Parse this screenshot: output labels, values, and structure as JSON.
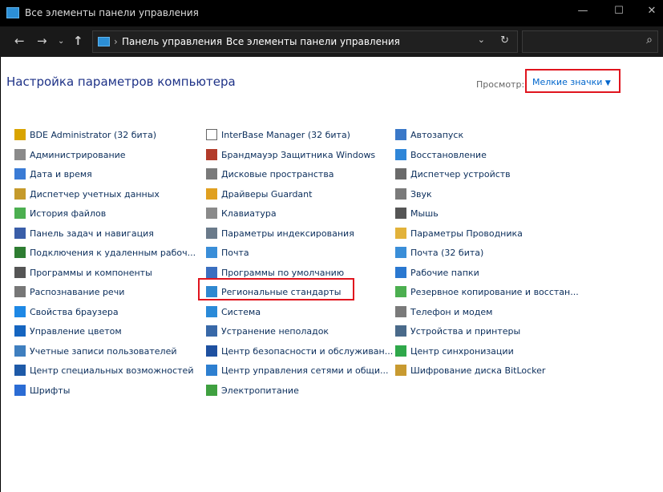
{
  "window": {
    "title": "Все элементы панели управления"
  },
  "address": {
    "crumbs": [
      "Панель управления",
      "Все элементы панели управления"
    ]
  },
  "header": {
    "title": "Настройка параметров компьютера",
    "view_label": "Просмотр:",
    "view_value": "Мелкие значки"
  },
  "columns": [
    [
      {
        "label": "BDE Administrator (32 бита)",
        "icon": "bde-icon",
        "color": "#d9a400"
      },
      {
        "label": "Администрирование",
        "icon": "admin-tools-icon",
        "color": "#8a8a8a"
      },
      {
        "label": "Дата и время",
        "icon": "clock-icon",
        "color": "#3a7bd5"
      },
      {
        "label": "Диспетчер учетных данных",
        "icon": "credential-icon",
        "color": "#c59a2b"
      },
      {
        "label": "История файлов",
        "icon": "file-history-icon",
        "color": "#4caf50"
      },
      {
        "label": "Панель задач и навигация",
        "icon": "taskbar-icon",
        "color": "#3a5ea8"
      },
      {
        "label": "Подключения к удаленным рабоч...",
        "icon": "remote-desktop-icon",
        "color": "#2e7d32"
      },
      {
        "label": "Программы и компоненты",
        "icon": "programs-icon",
        "color": "#555555"
      },
      {
        "label": "Распознавание речи",
        "icon": "microphone-icon",
        "color": "#777777"
      },
      {
        "label": "Свойства браузера",
        "icon": "internet-options-icon",
        "color": "#1e88e5"
      },
      {
        "label": "Управление цветом",
        "icon": "color-management-icon",
        "color": "#1565c0"
      },
      {
        "label": "Учетные записи пользователей",
        "icon": "users-icon",
        "color": "#3f7fbf"
      },
      {
        "label": "Центр специальных возможностей",
        "icon": "accessibility-icon",
        "color": "#1e5aa8"
      },
      {
        "label": "Шрифты",
        "icon": "fonts-icon",
        "color": "#2b6cd4"
      }
    ],
    [
      {
        "label": "InterBase Manager (32 бита)",
        "icon": "document-icon",
        "color": "#ffffff"
      },
      {
        "label": "Брандмауэр Защитника Windows",
        "icon": "firewall-icon",
        "color": "#b23b2a"
      },
      {
        "label": "Дисковые пространства",
        "icon": "storage-icon",
        "color": "#7a7a7a"
      },
      {
        "label": "Драйверы Guardant",
        "icon": "guardant-icon",
        "color": "#e0a020"
      },
      {
        "label": "Клавиатура",
        "icon": "keyboard-icon",
        "color": "#8a8a8a"
      },
      {
        "label": "Параметры индексирования",
        "icon": "indexing-icon",
        "color": "#6a7a8a"
      },
      {
        "label": "Почта",
        "icon": "mail-icon",
        "color": "#3a8ed8"
      },
      {
        "label": "Программы по умолчанию",
        "icon": "default-programs-icon",
        "color": "#3a6fc0"
      },
      {
        "label": "Региональные стандарты",
        "icon": "region-icon",
        "color": "#2f88d0"
      },
      {
        "label": "Система",
        "icon": "system-icon",
        "color": "#2a8ad8"
      },
      {
        "label": "Устранение неполадок",
        "icon": "troubleshoot-icon",
        "color": "#3868a8"
      },
      {
        "label": "Центр безопасности и обслуживан...",
        "icon": "flag-icon",
        "color": "#1e50a0"
      },
      {
        "label": "Центр управления сетями и общи...",
        "icon": "network-icon",
        "color": "#2d7fd0"
      },
      {
        "label": "Электропитание",
        "icon": "power-icon",
        "color": "#3fa040"
      }
    ],
    [
      {
        "label": "Автозапуск",
        "icon": "autoplay-icon",
        "color": "#3a78c8"
      },
      {
        "label": "Восстановление",
        "icon": "recovery-icon",
        "color": "#2f86d8"
      },
      {
        "label": "Диспетчер устройств",
        "icon": "device-manager-icon",
        "color": "#6a6a6a"
      },
      {
        "label": "Звук",
        "icon": "speaker-icon",
        "color": "#7a7a7a"
      },
      {
        "label": "Мышь",
        "icon": "mouse-icon",
        "color": "#555555"
      },
      {
        "label": "Параметры Проводника",
        "icon": "explorer-options-icon",
        "color": "#e2b23a"
      },
      {
        "label": "Почта (32 бита)",
        "icon": "mail-icon",
        "color": "#3a8ed8"
      },
      {
        "label": "Рабочие папки",
        "icon": "work-folders-icon",
        "color": "#2a78d0"
      },
      {
        "label": "Резервное копирование и восстан...",
        "icon": "backup-icon",
        "color": "#4caf50"
      },
      {
        "label": "Телефон и модем",
        "icon": "phone-modem-icon",
        "color": "#7a7a7a"
      },
      {
        "label": "Устройства и принтеры",
        "icon": "printer-icon",
        "color": "#4a6a8a"
      },
      {
        "label": "Центр синхронизации",
        "icon": "sync-icon",
        "color": "#2fa84a"
      },
      {
        "label": "Шифрование диска BitLocker",
        "icon": "bitlocker-icon",
        "color": "#c89a30"
      }
    ]
  ]
}
